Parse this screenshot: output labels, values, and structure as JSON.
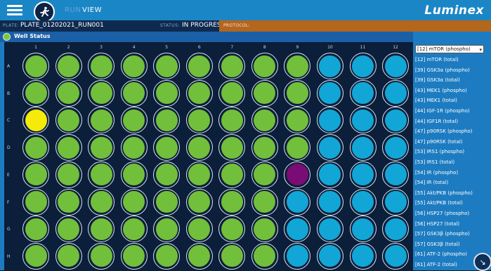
{
  "header": {
    "nav_dim": "RUN",
    "nav_view": "VIEW",
    "brand": "Luminex"
  },
  "info": {
    "plate_label": "PLATE:",
    "plate_value": "PLATE_01202021_RUN001",
    "status_label": "STATUS:",
    "status_value": "IN PROGRESS",
    "protocol_label": "PROTOCOL:"
  },
  "well_status": {
    "title": "Well Status",
    "columns": [
      "1",
      "2",
      "3",
      "4",
      "5",
      "6",
      "7",
      "8",
      "9",
      "10",
      "11",
      "12"
    ],
    "rows": [
      "A",
      "B",
      "C",
      "D",
      "E",
      "F",
      "G",
      "H"
    ],
    "grid": [
      [
        "green",
        "green",
        "green",
        "green",
        "green",
        "green",
        "green",
        "green",
        "green",
        "blue",
        "blue",
        "blue"
      ],
      [
        "green",
        "green",
        "green",
        "green",
        "green",
        "green",
        "green",
        "green",
        "green",
        "blue",
        "blue",
        "blue"
      ],
      [
        "yellow",
        "green",
        "green",
        "green",
        "green",
        "green",
        "green",
        "green",
        "green",
        "blue",
        "blue",
        "blue"
      ],
      [
        "green",
        "green",
        "green",
        "green",
        "green",
        "green",
        "green",
        "green",
        "green",
        "blue",
        "blue",
        "blue"
      ],
      [
        "green",
        "green",
        "green",
        "green",
        "green",
        "green",
        "green",
        "green",
        "purple",
        "blue",
        "blue",
        "blue"
      ],
      [
        "green",
        "green",
        "green",
        "green",
        "green",
        "green",
        "green",
        "green",
        "blue",
        "blue",
        "blue",
        "blue"
      ],
      [
        "green",
        "green",
        "green",
        "green",
        "green",
        "green",
        "green",
        "green",
        "blue",
        "blue",
        "blue",
        "blue"
      ],
      [
        "green",
        "green",
        "green",
        "green",
        "green",
        "green",
        "green",
        "green",
        "blue",
        "blue",
        "blue",
        "blue"
      ]
    ],
    "colors": {
      "green": "#72bf3b",
      "blue": "#12a6d6",
      "yellow": "#f5ea0a",
      "purple": "#7a0c76"
    }
  },
  "analytes": {
    "selected": "[12] mTOR (phospho)",
    "list": [
      "[12] mTOR (total)",
      "[39] GSK3α (phospho)",
      "[39] GSK3α (total)",
      "[43] MEK1 (phospho)",
      "[43] MEK1 (total)",
      "[44] IGF-1R (phospho)",
      "[44] IGF1R (total)",
      "[47] p90RSK (phospho)",
      "[47] p90RSK (total)",
      "[53] IRS1 (phospho)",
      "[53] IRS1 (total)",
      "[54] IR (phospho)",
      "[54] IR (total)",
      "[55] Akt/PKB (phospho)",
      "[55] Akt/PKB (total)",
      "[56] HSP27 (phospho)",
      "[56] HSP27 (total)",
      "[57] GSK3β (phospho)",
      "[57] GSK3β (total)",
      "[61] ATF-2 (phospho)",
      "[61] ATF-2 (total)"
    ]
  }
}
